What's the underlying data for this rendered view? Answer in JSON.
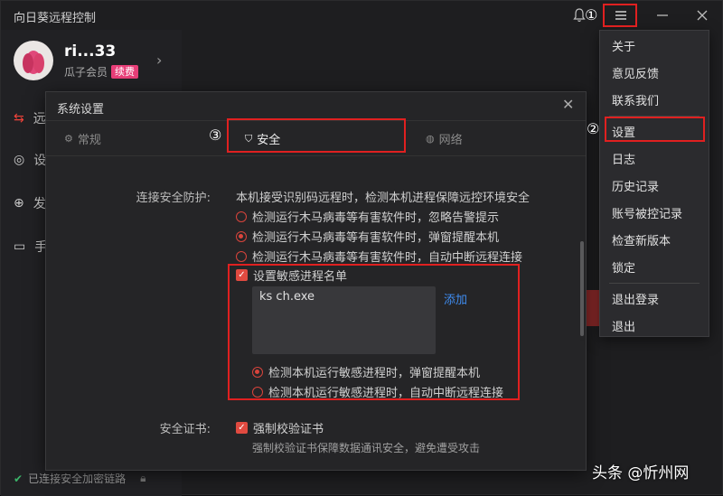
{
  "window": {
    "title": "向日葵远程控制"
  },
  "profile": {
    "username": "ri...33",
    "member": "瓜子会员",
    "renew": "续费"
  },
  "nav": [
    {
      "label": "远",
      "icon": "remote-icon"
    },
    {
      "label": "设",
      "icon": "device-icon"
    },
    {
      "label": "发",
      "icon": "discover-icon"
    },
    {
      "label": "手",
      "icon": "screen-icon"
    }
  ],
  "status": {
    "text": "已连接安全加密链路"
  },
  "dialog": {
    "title": "系统设置",
    "tabs": [
      {
        "label": "常规"
      },
      {
        "label": "安全"
      },
      {
        "label": "网络"
      }
    ],
    "security": {
      "protection_label": "连接安全防护:",
      "protection_desc": "本机接受识别码远程时，检测本机进程保障远控环境安全",
      "options": [
        {
          "label": "检测运行木马病毒等有害软件时，忽略告警提示",
          "selected": false
        },
        {
          "label": "检测运行木马病毒等有害软件时，弹窗提醒本机",
          "selected": true
        },
        {
          "label": "检测运行木马病毒等有害软件时，自动中断远程连接",
          "selected": false
        }
      ],
      "sensitive_list_label": "设置敏感进程名单",
      "sensitive_list_checked": true,
      "process_items": [
        "ks        ch.exe"
      ],
      "add_label": "添加",
      "process_options": [
        {
          "label": "检测本机运行敏感进程时，弹窗提醒本机",
          "selected": true
        },
        {
          "label": "检测本机运行敏感进程时，自动中断远程连接",
          "selected": false
        }
      ],
      "cert_label": "安全证书:",
      "cert_check_label": "强制校验证书",
      "cert_checked": true,
      "cert_hint": "强制校验证书保障数据通讯安全，避免遭受攻击"
    }
  },
  "menu": {
    "items": [
      "关于",
      "意见反馈",
      "联系我们",
      "设置",
      "日志",
      "历史记录",
      "账号被控记录",
      "检查新版本",
      "锁定",
      "退出登录",
      "退出"
    ]
  },
  "annotations": {
    "step1": "①",
    "step2": "②",
    "step3": "③"
  },
  "watermark": "头条 @忻州网",
  "colors": {
    "accent": "#e04a40",
    "link": "#3f8cf0",
    "highlight_box": "#e02020"
  }
}
